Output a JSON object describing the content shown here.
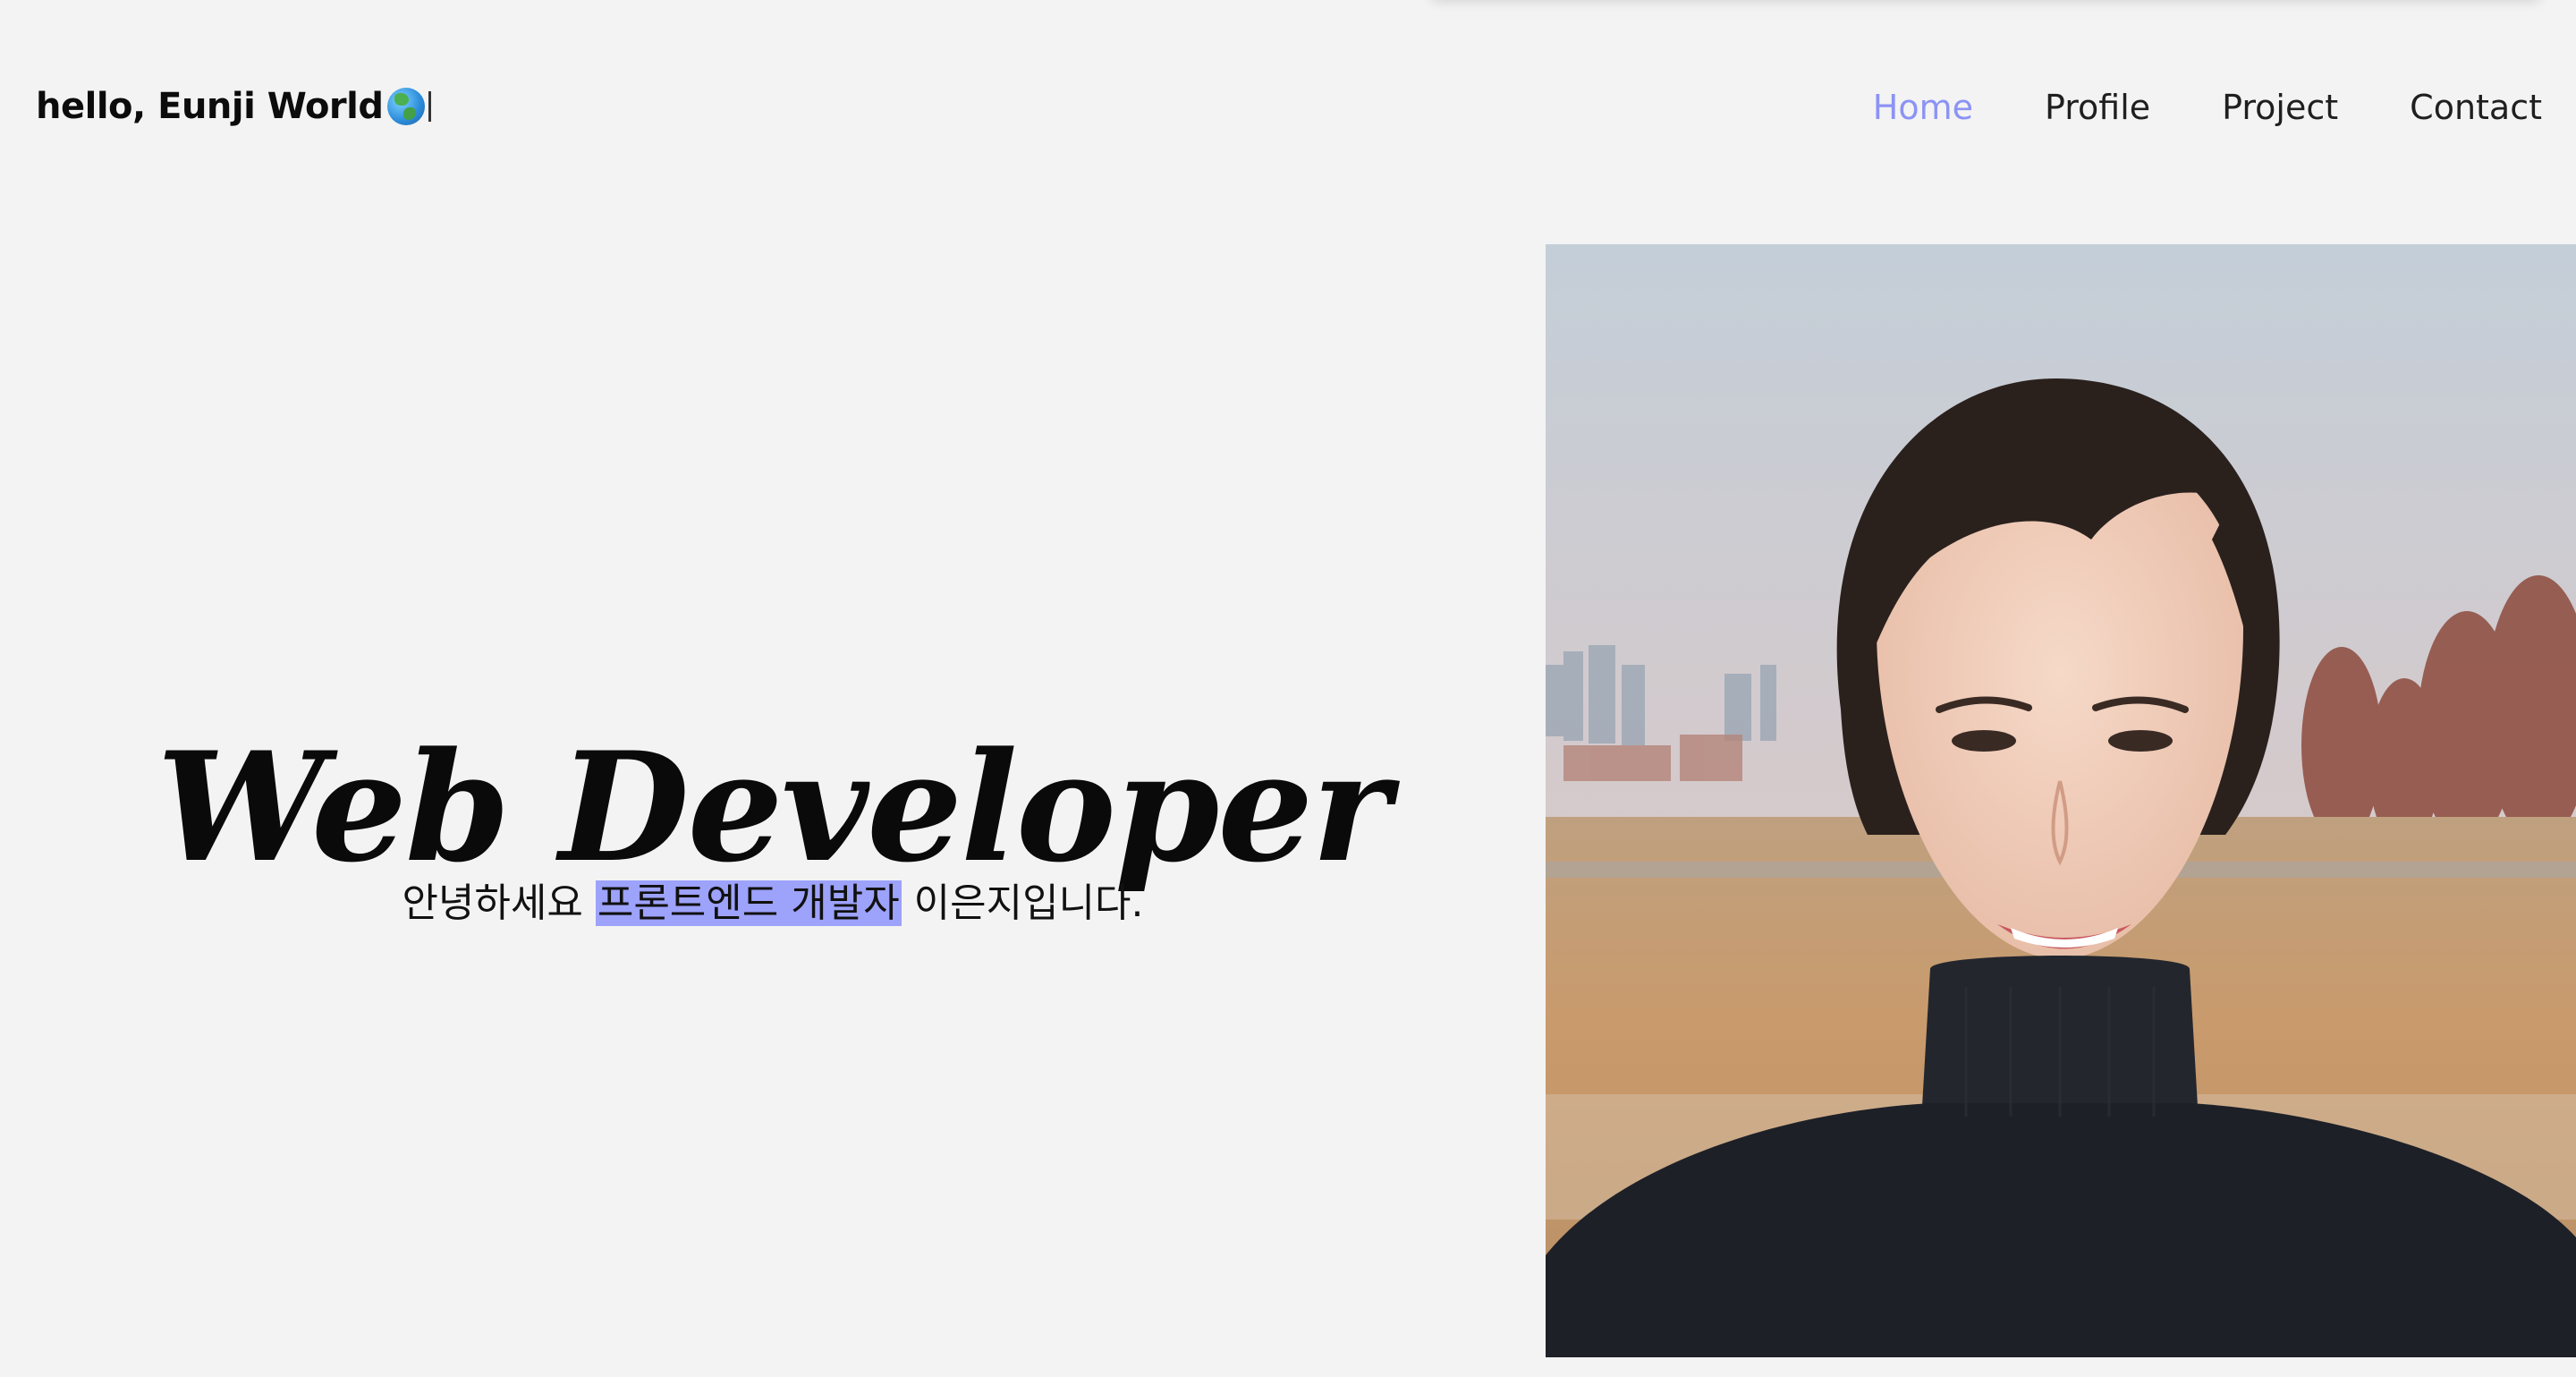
{
  "header": {
    "logo_text": "hello, Eunji World",
    "logo_icon": "globe-icon"
  },
  "nav": {
    "items": [
      {
        "label": "Home",
        "active": true
      },
      {
        "label": "Profile",
        "active": false
      },
      {
        "label": "Project",
        "active": false
      },
      {
        "label": "Contact",
        "active": false
      }
    ]
  },
  "hero": {
    "title": "Web Developer",
    "subtitle_before": "안녕하세요 ",
    "subtitle_highlight": "프론트엔드 개발자",
    "subtitle_after": " 이은지입니다."
  },
  "photo": {
    "alt": "Profile photo of Eunji"
  },
  "colors": {
    "background": "#f3f3f3",
    "accent": "#8c93f5",
    "highlight": "#9da2fb",
    "text": "#111111"
  }
}
